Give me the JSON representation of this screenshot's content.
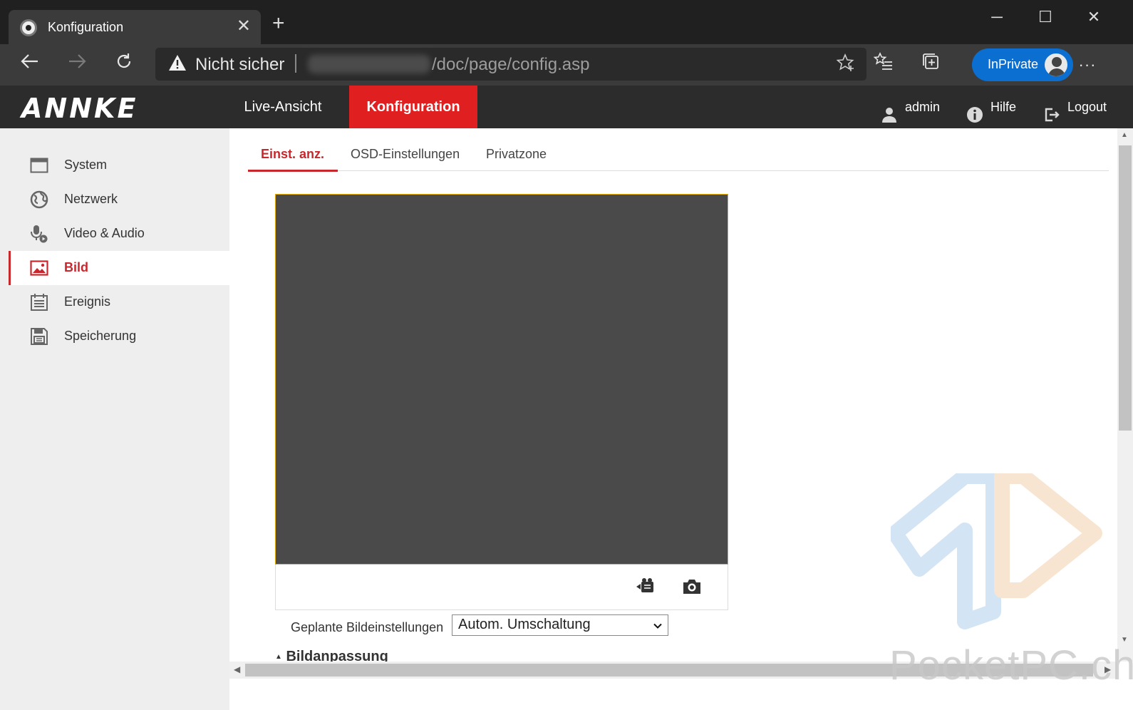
{
  "browser": {
    "tab_title": "Konfiguration",
    "tab_close": "✕",
    "new_tab": "+",
    "security_warning": "Nicht sicher",
    "url_path": "/doc/page/config.asp",
    "inprivate_label": "InPrivate",
    "window_controls": {
      "minimize": "─",
      "maximize": "☐",
      "close": "✕"
    },
    "more_menu": "···"
  },
  "header": {
    "logo": "ANNKE",
    "nav": [
      {
        "label": "Live-Ansicht",
        "active": false
      },
      {
        "label": "Konfiguration",
        "active": true
      }
    ],
    "user": "admin",
    "help": "Hilfe",
    "logout": "Logout",
    "accent_color": "#e02020"
  },
  "sidebar": {
    "items": [
      {
        "label": "System",
        "icon": "window-icon",
        "active": false
      },
      {
        "label": "Netzwerk",
        "icon": "globe-icon",
        "active": false
      },
      {
        "label": "Video & Audio",
        "icon": "microphone-icon",
        "active": false
      },
      {
        "label": "Bild",
        "icon": "image-icon",
        "active": true
      },
      {
        "label": "Ereignis",
        "icon": "calendar-icon",
        "active": false
      },
      {
        "label": "Speicherung",
        "icon": "floppy-disk-icon",
        "active": false
      }
    ]
  },
  "main": {
    "subtabs": [
      {
        "label": "Einst. anz.",
        "active": true
      },
      {
        "label": "OSD-Einstellungen",
        "active": false
      },
      {
        "label": "Privatzone",
        "active": false
      }
    ],
    "scheduled_label": "Geplante Bildeinstellungen",
    "scheduled_value": "Autom. Umschaltung",
    "section_title": "Bildanpassung"
  },
  "watermark": "PocketPC.ch"
}
